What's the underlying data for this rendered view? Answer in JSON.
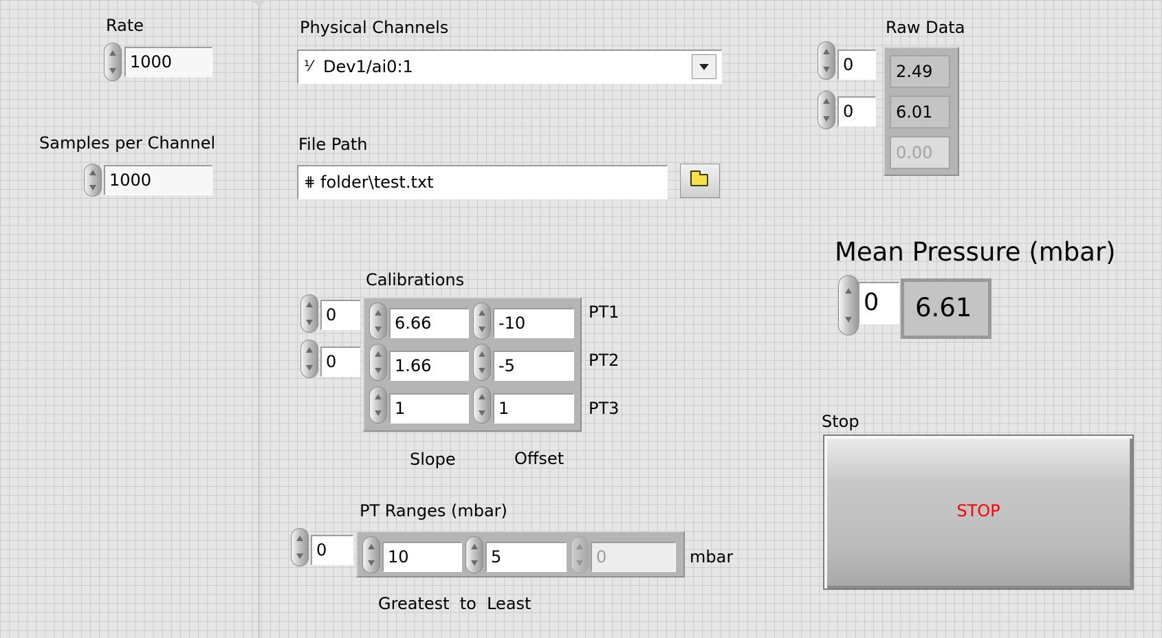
{
  "rate": {
    "label": "Rate",
    "value": "1000"
  },
  "samples_per_channel": {
    "label": "Samples per Channel",
    "value": "1000"
  },
  "physical_channels": {
    "label": "Physical Channels",
    "value": "Dev1/ai0:1",
    "glyph": "I/O"
  },
  "file_path": {
    "label": "File Path",
    "value": "folder\\test.txt"
  },
  "raw_data": {
    "label": "Raw Data",
    "index_row": "0",
    "index_col": "0",
    "values": [
      "2.49",
      "6.01",
      "0.00"
    ]
  },
  "mean_pressure": {
    "label": "Mean Pressure (mbar)",
    "index": "0",
    "value": "6.61"
  },
  "calibrations": {
    "label": "Calibrations",
    "index_row": "0",
    "index_col": "0",
    "rows": [
      {
        "slope": "6.66",
        "offset": "-10",
        "name": "PT1"
      },
      {
        "slope": "1.66",
        "offset": "-5",
        "name": "PT2"
      },
      {
        "slope": "1",
        "offset": "1",
        "name": "PT3"
      }
    ],
    "slope_label": "Slope",
    "offset_label": "Offset"
  },
  "pt_ranges": {
    "label": "PT Ranges (mbar)",
    "index": "0",
    "values": [
      "10",
      "5",
      "0"
    ],
    "unit": "mbar",
    "caption": "Greatest  to  Least"
  },
  "stop": {
    "label": "Stop",
    "button_text": "STOP",
    "button_color": "#ff0000"
  }
}
